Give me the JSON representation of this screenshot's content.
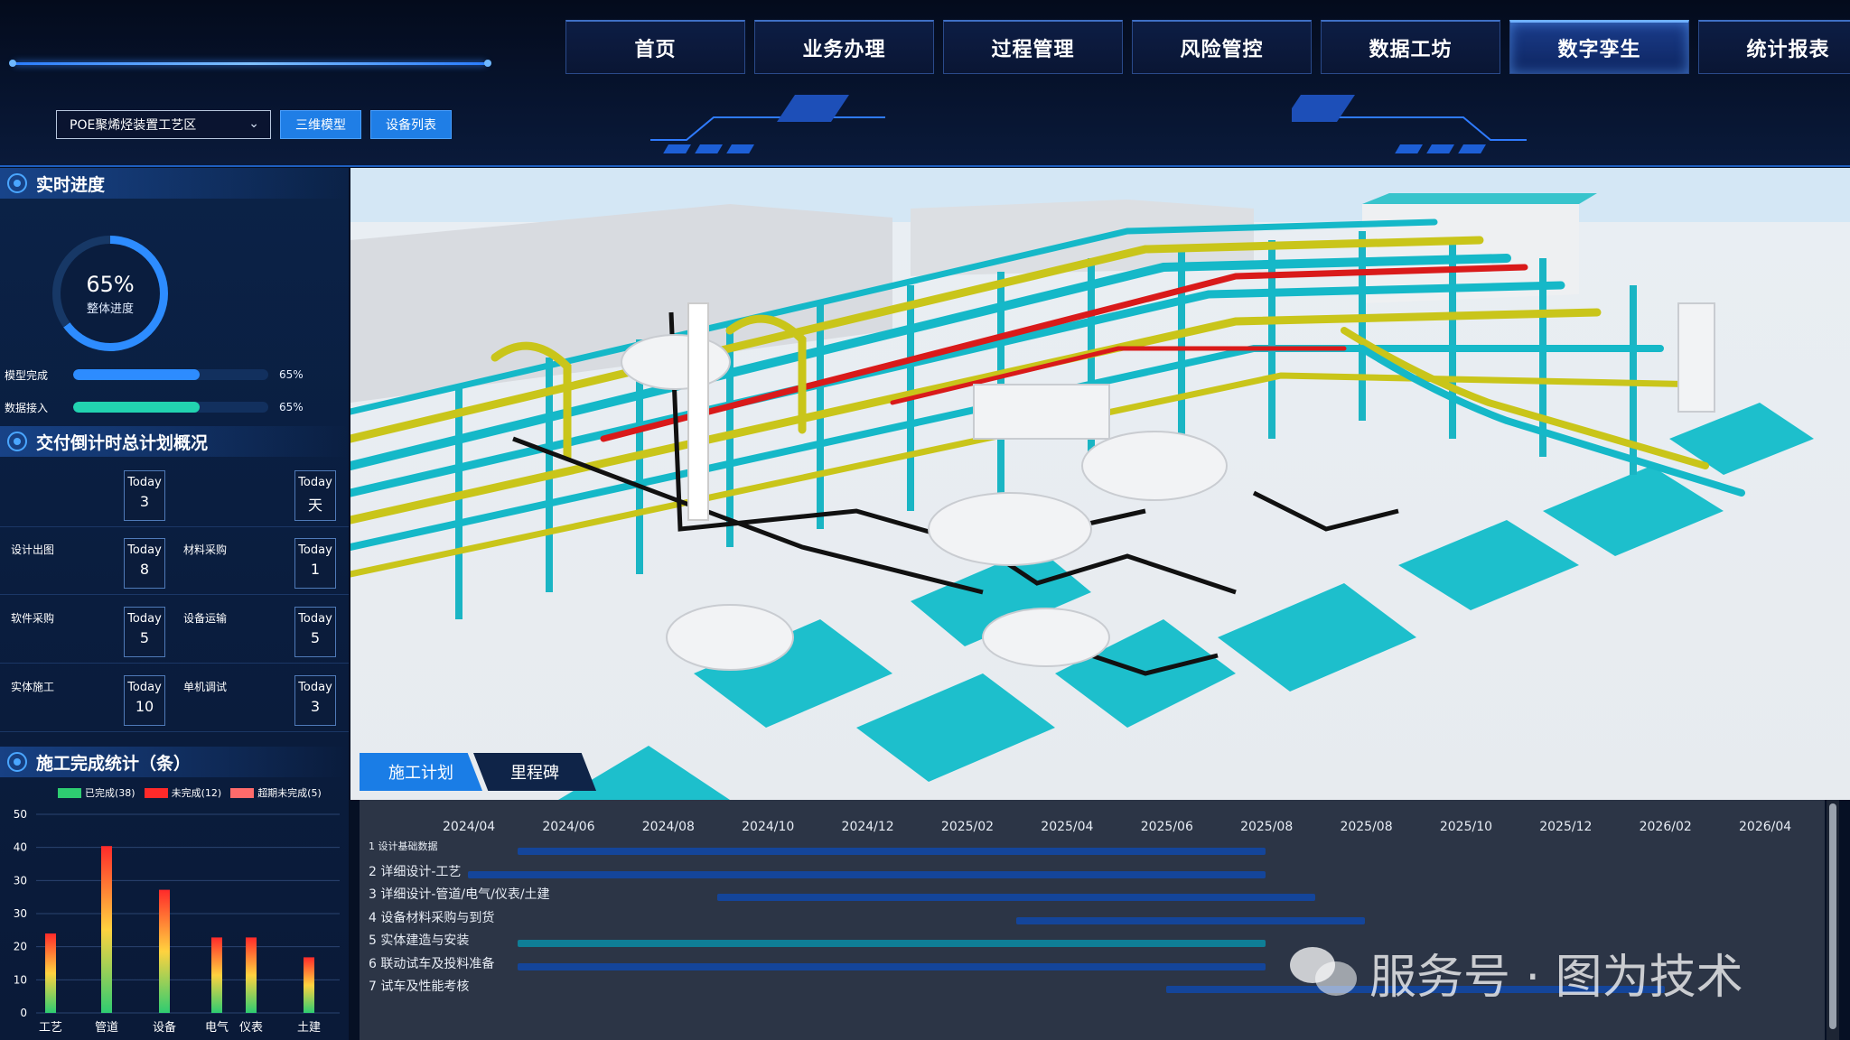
{
  "nav": {
    "items": [
      "首页",
      "业务办理",
      "过程管理",
      "风险管控",
      "数据工坊",
      "数字孪生",
      "统计报表"
    ],
    "active_index": 5
  },
  "toolbar": {
    "area_select": "POE聚烯烃装置工艺区",
    "btn_3d": "三维模型",
    "btn_equipment": "设备列表"
  },
  "progress": {
    "title": "实时进度",
    "overall_pct": "65%",
    "overall_label": "整体进度",
    "overall_value": 0.65,
    "bars": [
      {
        "label": "模型完成",
        "value_text": "65%",
        "value": 0.65,
        "color": "#2d8cff"
      },
      {
        "label": "数据接入",
        "value_text": "65%",
        "value": 0.65,
        "color": "#22d3b0"
      }
    ]
  },
  "countdown": {
    "title": "交付倒计时总计划概况",
    "today_label": "Today",
    "rows": [
      {
        "left_label": "",
        "left_value": "3",
        "right_label": "",
        "right_value": "天"
      },
      {
        "left_label": "设计出图",
        "left_value": "8",
        "right_label": "材料采购",
        "right_value": "1"
      },
      {
        "left_label": "软件采购",
        "left_value": "5",
        "right_label": "设备运输",
        "right_value": "5"
      },
      {
        "left_label": "实体施工",
        "left_value": "10",
        "right_label": "单机调试",
        "right_value": "3"
      }
    ]
  },
  "stats": {
    "title": "施工完成统计（条）",
    "legend": [
      {
        "label": "已完成(38)",
        "color": "#2ecc71"
      },
      {
        "label": "未完成(12)",
        "color": "#ff2a2a"
      },
      {
        "label": "超期未完成(5)",
        "color": "#ff6b6b"
      }
    ]
  },
  "chart_data": {
    "type": "bar",
    "categories": [
      "工艺",
      "管道",
      "设备",
      "电气",
      "仪表",
      "土建"
    ],
    "values": [
      20,
      42,
      31,
      19,
      19,
      14
    ],
    "yticks": [
      "50",
      "40",
      "30",
      "30",
      "20",
      "10",
      "0"
    ],
    "ylim": [
      0,
      50
    ],
    "bar_gradient": [
      "#2ecc71",
      "#ffd23f",
      "#ff2a2a"
    ]
  },
  "schedule": {
    "tabs": [
      "施工计划",
      "里程碑"
    ],
    "active_tab": 0,
    "months": [
      "2024/04",
      "2024/06",
      "2024/08",
      "2024/10",
      "2024/12",
      "2025/02",
      "2025/04",
      "2025/06",
      "2025/08",
      "2025/08",
      "2025/10",
      "2025/12",
      "2026/02",
      "2026/04"
    ],
    "tasks": [
      {
        "label": "1 设计基础数据",
        "start": "2024/05",
        "end": "2025/08"
      },
      {
        "label": "2 详细设计-工艺",
        "start": "2024/04",
        "end": "2025/08"
      },
      {
        "label": "3 详细设计-管道/电气/仪表/土建",
        "start": "2024/09",
        "end": "2025/09"
      },
      {
        "label": "4 设备材料采购与到货",
        "start": "2025/03",
        "end": "2025/10"
      },
      {
        "label": "5 实体建造与安装",
        "start": "2024/05",
        "end": "2025/08"
      },
      {
        "label": "6 联动试车及投料准备",
        "start": "2024/05",
        "end": "2025/08"
      },
      {
        "label": "7 试车及性能考核",
        "start": "2025/06",
        "end": "2026/04"
      }
    ]
  },
  "watermark": "服务号 · 图为技术"
}
